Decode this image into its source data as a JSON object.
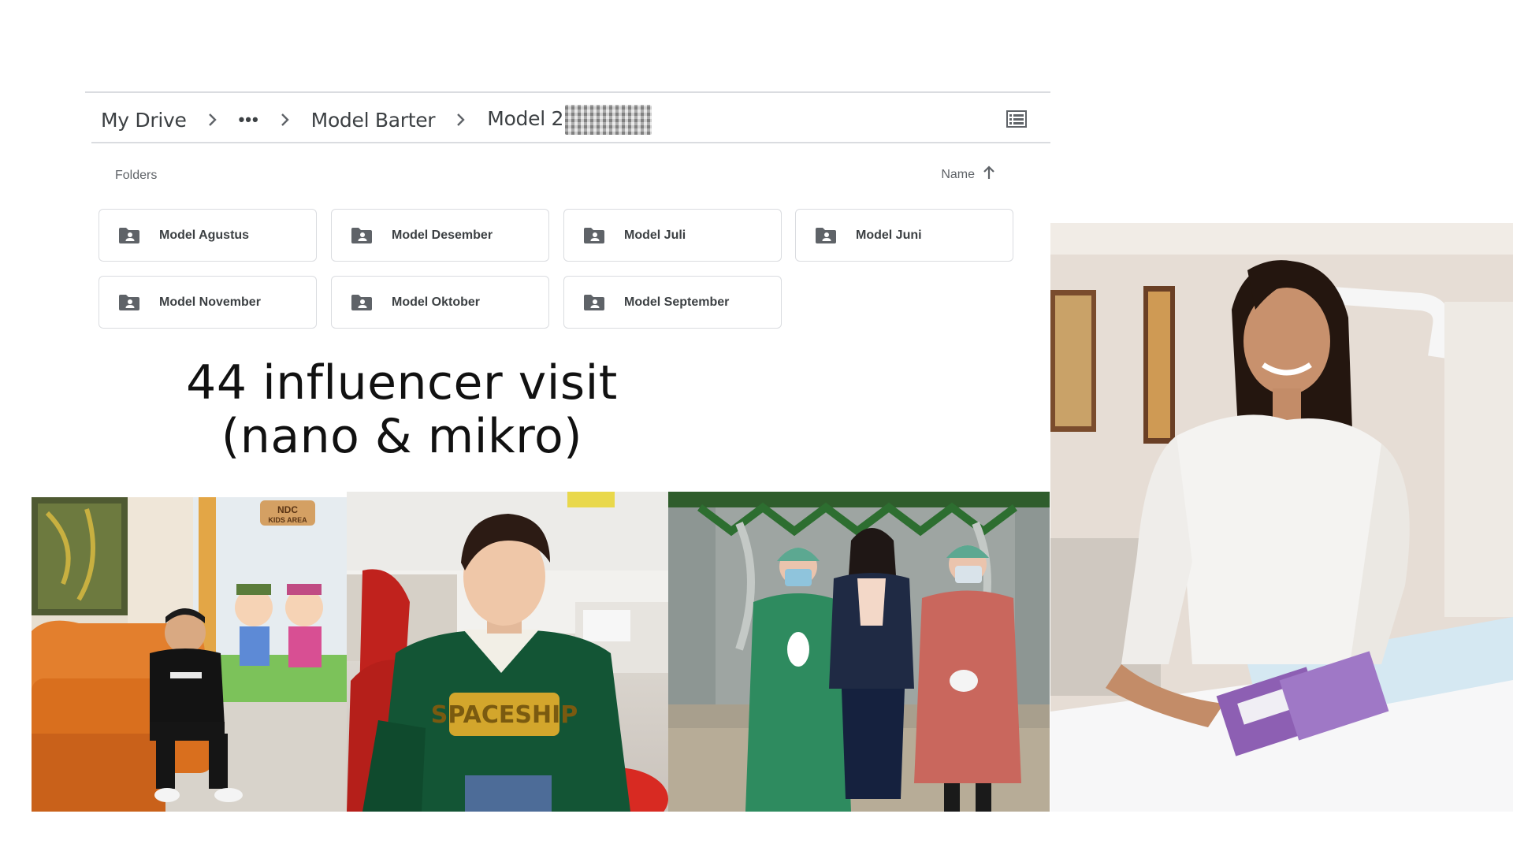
{
  "breadcrumb": {
    "root": "My Drive",
    "more": "•••",
    "parent": "Model Barter",
    "current": "Model 2"
  },
  "section": {
    "label": "Folders",
    "sort_label": "Name"
  },
  "folders": [
    {
      "name": "Model Agustus"
    },
    {
      "name": "Model Desember"
    },
    {
      "name": "Model Juli"
    },
    {
      "name": "Model Juni"
    },
    {
      "name": "Model November"
    },
    {
      "name": "Model Oktober"
    },
    {
      "name": "Model September"
    }
  ],
  "headline": {
    "line1": "44 influencer visit",
    "line2": "(nano & mikro)"
  },
  "photo_signs": {
    "kids_area_top": "NDC",
    "kids_area_bottom": "KIDS AREA",
    "sweater_text": "SPACESHIP"
  },
  "colors": {
    "border": "#dadce0",
    "icon": "#5f6368",
    "text": "#3c4043"
  }
}
